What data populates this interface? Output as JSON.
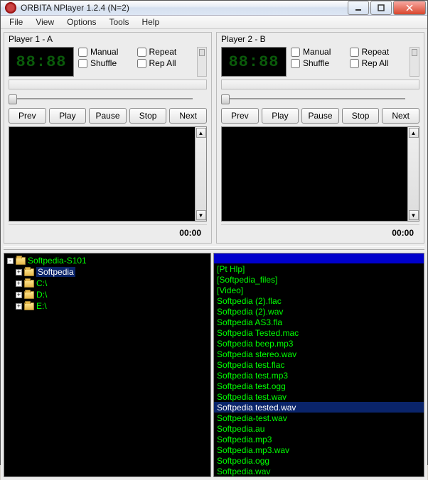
{
  "window": {
    "title": "ORBITA NPlayer 1.2.4 (N=2)"
  },
  "menu": {
    "file": "File",
    "view": "View",
    "options": "Options",
    "tools": "Tools",
    "help": "Help"
  },
  "player1": {
    "title": "Player 1 - A",
    "lcd": "88:88",
    "time": "00:00",
    "opts": {
      "manual": "Manual",
      "repeat": "Repeat",
      "shuffle": "Shuffle",
      "repall": "Rep All"
    },
    "btns": {
      "prev": "Prev",
      "play": "Play",
      "pause": "Pause",
      "stop": "Stop",
      "next": "Next"
    }
  },
  "player2": {
    "title": "Player 2 - B",
    "lcd": "88:88",
    "time": "00:00",
    "opts": {
      "manual": "Manual",
      "repeat": "Repeat",
      "shuffle": "Shuffle",
      "repall": "Rep All"
    },
    "btns": {
      "prev": "Prev",
      "play": "Play",
      "pause": "Pause",
      "stop": "Stop",
      "next": "Next"
    }
  },
  "tree": [
    {
      "expander": "-",
      "label": "Softpedia-S101",
      "depth": 0,
      "selected": false
    },
    {
      "expander": "+",
      "label": "Softpedia",
      "depth": 1,
      "selected": true
    },
    {
      "expander": "+",
      "label": "C:\\",
      "depth": 1,
      "selected": false
    },
    {
      "expander": "+",
      "label": "D:\\",
      "depth": 1,
      "selected": false
    },
    {
      "expander": "+",
      "label": "E:\\",
      "depth": 1,
      "selected": false
    }
  ],
  "files": [
    {
      "label": "[Pt Hlp]",
      "selected": false
    },
    {
      "label": "[Softpedia_files]",
      "selected": false
    },
    {
      "label": "[Video]",
      "selected": false
    },
    {
      "label": "Softpedia (2).flac",
      "selected": false
    },
    {
      "label": "Softpedia (2).wav",
      "selected": false
    },
    {
      "label": "Softpedia AS3.fla",
      "selected": false
    },
    {
      "label": "Softpedia Tested.mac",
      "selected": false
    },
    {
      "label": "Softpedia beep.mp3",
      "selected": false
    },
    {
      "label": "Softpedia stereo.wav",
      "selected": false
    },
    {
      "label": "Softpedia test.flac",
      "selected": false
    },
    {
      "label": "Softpedia test.mp3",
      "selected": false
    },
    {
      "label": "Softpedia test.ogg",
      "selected": false
    },
    {
      "label": "Softpedia test.wav",
      "selected": false
    },
    {
      "label": "Softpedia tested.wav",
      "selected": true
    },
    {
      "label": "Softpedia-test.wav",
      "selected": false
    },
    {
      "label": "Softpedia.au",
      "selected": false
    },
    {
      "label": "Softpedia.mp3",
      "selected": false
    },
    {
      "label": "Softpedia.mp3.wav",
      "selected": false
    },
    {
      "label": "Softpedia.ogg",
      "selected": false
    },
    {
      "label": "Softpedia.wav",
      "selected": false
    }
  ]
}
